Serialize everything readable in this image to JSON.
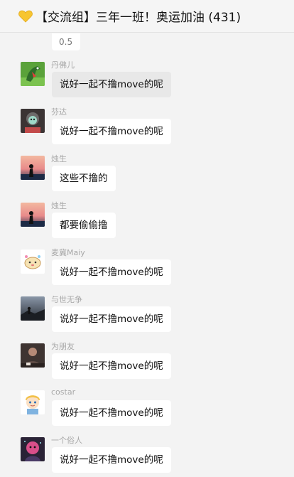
{
  "header": {
    "icon": "yellow-heart-icon",
    "title": "【交流组】三年一班！奥运加油 (431)"
  },
  "top_partial_text": "0.5",
  "messages": [
    {
      "sender": "丹佛儿",
      "text": "说好一起不撸move的呢",
      "avatar": "dinosaur-avatar",
      "highlighted": true
    },
    {
      "sender": "芬达",
      "text": "说好一起不撸move的呢",
      "avatar": "character-avatar",
      "highlighted": false
    },
    {
      "sender": "烛生",
      "text": "这些不撸的",
      "avatar": "silhouette-sunset-avatar",
      "highlighted": false
    },
    {
      "sender": "烛生",
      "text": "都要偷偷撸",
      "avatar": "silhouette-sunset-avatar",
      "highlighted": false
    },
    {
      "sender": "麦冀Maiy",
      "text": "说好一起不撸move的呢",
      "avatar": "cartoon-animal-avatar",
      "highlighted": false
    },
    {
      "sender": "与世无争",
      "text": "说好一起不撸move的呢",
      "avatar": "dark-landscape-avatar",
      "highlighted": false
    },
    {
      "sender": "为朋友",
      "text": "说好一起不撸move的呢",
      "avatar": "person-photo-avatar",
      "highlighted": false
    },
    {
      "sender": "costar",
      "text": "说好一起不撸move的呢",
      "avatar": "cartoon-boy-avatar",
      "highlighted": false
    },
    {
      "sender": "一个俗人",
      "text": "说好一起不撸move的呢",
      "avatar": "pink-character-avatar",
      "highlighted": false
    }
  ]
}
